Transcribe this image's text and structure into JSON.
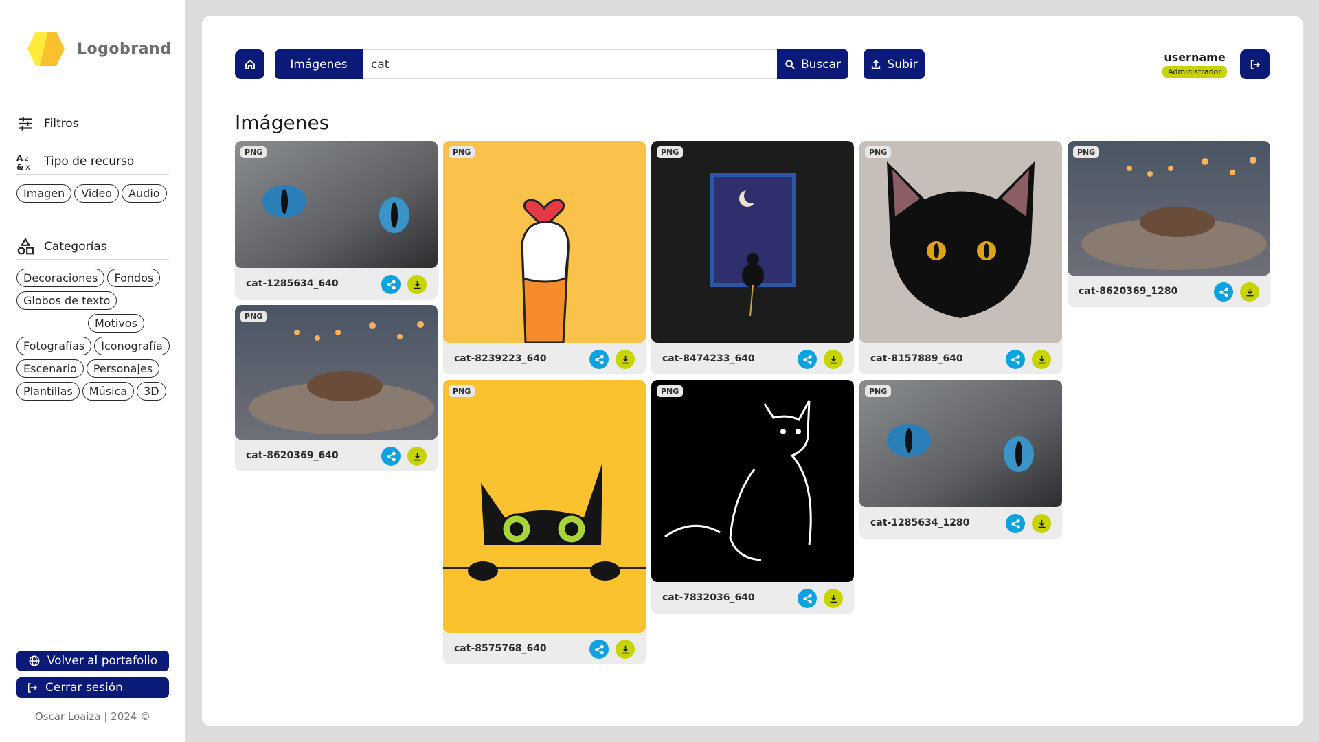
{
  "brand": {
    "name": "Logobrand"
  },
  "sidebar": {
    "filters_label": "Filtros",
    "resource_type_label": "Tipo de recurso",
    "resource_types": [
      "Imagen",
      "Video",
      "Audio"
    ],
    "categories_label": "Categorías",
    "categories": [
      "Decoraciones",
      "Fondos",
      "Globos de texto",
      "Motivos",
      "Fotografías",
      "Iconografía",
      "Escenario",
      "Personajes",
      "Plantillas",
      "Música",
      "3D"
    ],
    "portfolio_button": "Volver al portafolio",
    "logout_button": "Cerrar sesión",
    "footer": "Oscar Loaiza | 2024 ©"
  },
  "header": {
    "type_select": "Imágenes",
    "search_value": "cat",
    "search_button": "Buscar",
    "upload_button": "Subir",
    "username": "username",
    "role": "Administrador"
  },
  "main": {
    "title": "Imágenes",
    "cards": [
      {
        "badge": "PNG",
        "name": "cat-1285634_640",
        "image": "gray cat with blue eyes close-up"
      },
      {
        "badge": "PNG",
        "name": "cat-8239223_640",
        "image": "cat paw with heart on yellow"
      },
      {
        "badge": "PNG",
        "name": "cat-8474233_640",
        "image": "cat at night window"
      },
      {
        "badge": "PNG",
        "name": "cat-8157889_640",
        "image": "black cat face illustration"
      },
      {
        "badge": "PNG",
        "name": "cat-8620369_1280",
        "image": "cat sleeping on blanket with lights"
      },
      {
        "badge": "PNG",
        "name": "cat-8620369_640",
        "image": "cat sleeping on blanket with lights"
      },
      {
        "badge": "PNG",
        "name": "cat-8575768_640",
        "image": "black kitten peeking on yellow"
      },
      {
        "badge": "PNG",
        "name": "cat-7832036_640",
        "image": "white line cat on black"
      },
      {
        "badge": "PNG",
        "name": "cat-1285634_1280",
        "image": "gray cat with blue eyes close-up"
      }
    ]
  },
  "colors": {
    "primary": "#0b1a78",
    "share": "#0aa2e0",
    "download": "#c8d400"
  }
}
